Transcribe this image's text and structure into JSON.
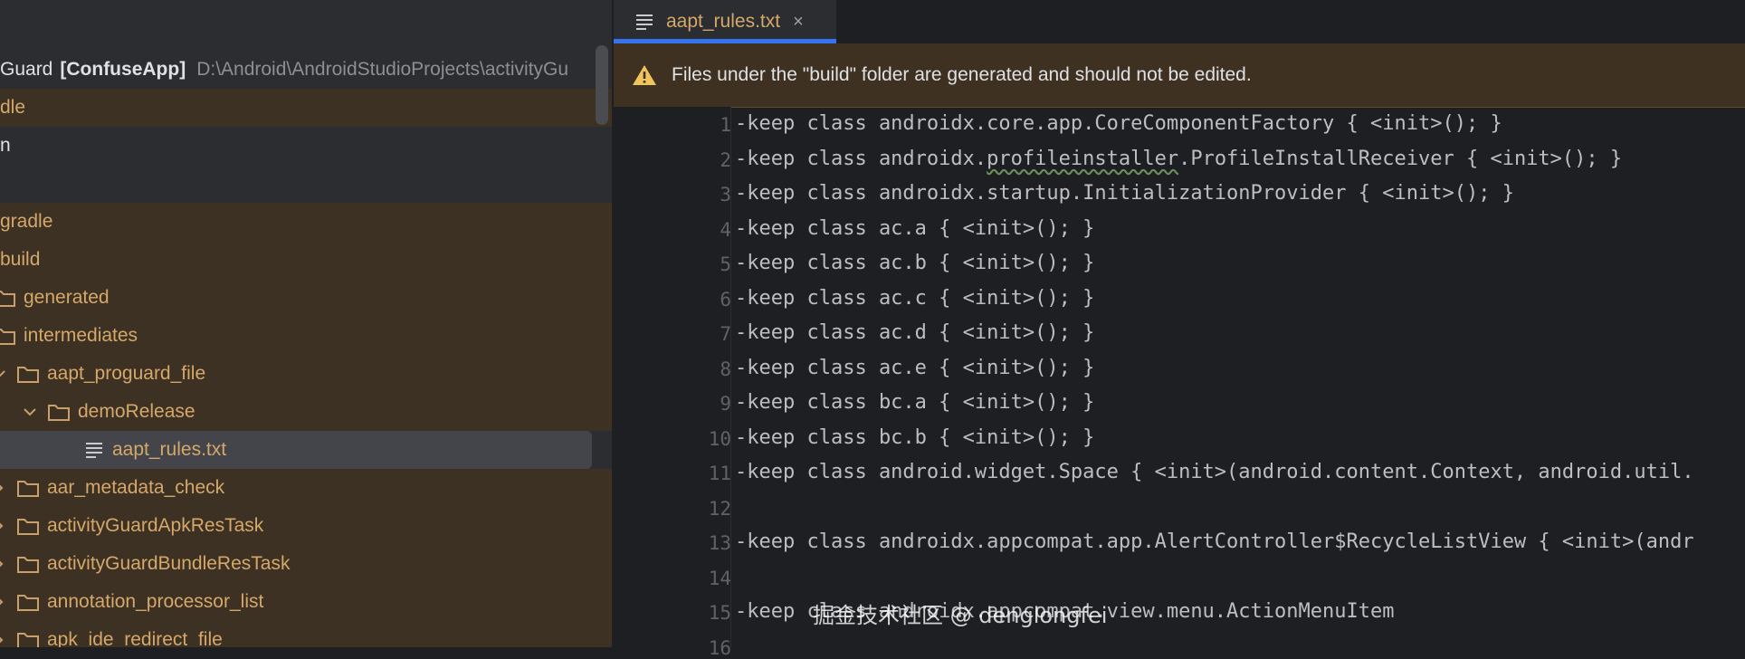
{
  "project_panel": {
    "root": {
      "name_partial": "Guard",
      "module": "[ConfuseApp]",
      "path": "D:\\Android\\AndroidStudioProjects\\activityGu"
    },
    "rows": [
      {
        "label": "dle"
      },
      {
        "label": "n"
      },
      {
        "label": "gradle"
      },
      {
        "label": "build"
      },
      {
        "label": "generated"
      },
      {
        "label": "intermediates"
      },
      {
        "label": "aapt_proguard_file"
      },
      {
        "label": "demoRelease"
      },
      {
        "label": "aapt_rules.txt"
      },
      {
        "label": "aar_metadata_check"
      },
      {
        "label": "activityGuardApkResTask"
      },
      {
        "label": "activityGuardBundleResTask"
      },
      {
        "label": "annotation_processor_list"
      },
      {
        "label": "apk_ide_redirect_file"
      }
    ]
  },
  "editor": {
    "tab": {
      "title": "aapt_rules.txt",
      "close": "×"
    },
    "warning": "Files under the \"build\" folder are generated and should not be edited.",
    "lines": [
      {
        "num": "1",
        "text": "-keep class androidx.core.app.CoreComponentFactory { <init>(); }"
      },
      {
        "num": "2",
        "pre": "-keep class androidx.",
        "squiggle": "profileinstaller",
        "post": ".ProfileInstallReceiver { <init>(); }"
      },
      {
        "num": "3",
        "text": "-keep class androidx.startup.InitializationProvider { <init>(); }"
      },
      {
        "num": "4",
        "text": "-keep class ac.a { <init>(); }"
      },
      {
        "num": "5",
        "text": "-keep class ac.b { <init>(); }"
      },
      {
        "num": "6",
        "text": "-keep class ac.c { <init>(); }"
      },
      {
        "num": "7",
        "text": "-keep class ac.d { <init>(); }"
      },
      {
        "num": "8",
        "text": "-keep class ac.e { <init>(); }"
      },
      {
        "num": "9",
        "text": "-keep class bc.a { <init>(); }"
      },
      {
        "num": "10",
        "text": "-keep class bc.b { <init>(); }"
      },
      {
        "num": "11",
        "text": "-keep class android.widget.Space { <init>(android.content.Context, android.util."
      },
      {
        "num": "12",
        "text": ""
      },
      {
        "num": "13",
        "text": "-keep class androidx.appcompat.app.AlertController$RecycleListView { <init>(andr"
      },
      {
        "num": "14",
        "text": ""
      },
      {
        "num": "15",
        "text": "-keep class androidx.appcompat.view.menu.ActionMenuItem"
      },
      {
        "num": "16",
        "text": ""
      }
    ]
  },
  "watermark": "掘金技术社区 @ denglongfei",
  "colors": {
    "accent": "#3574f0",
    "folder": "#d5a86a",
    "warning_bg": "#3e3121",
    "warning_icon": "#f2c55c"
  }
}
